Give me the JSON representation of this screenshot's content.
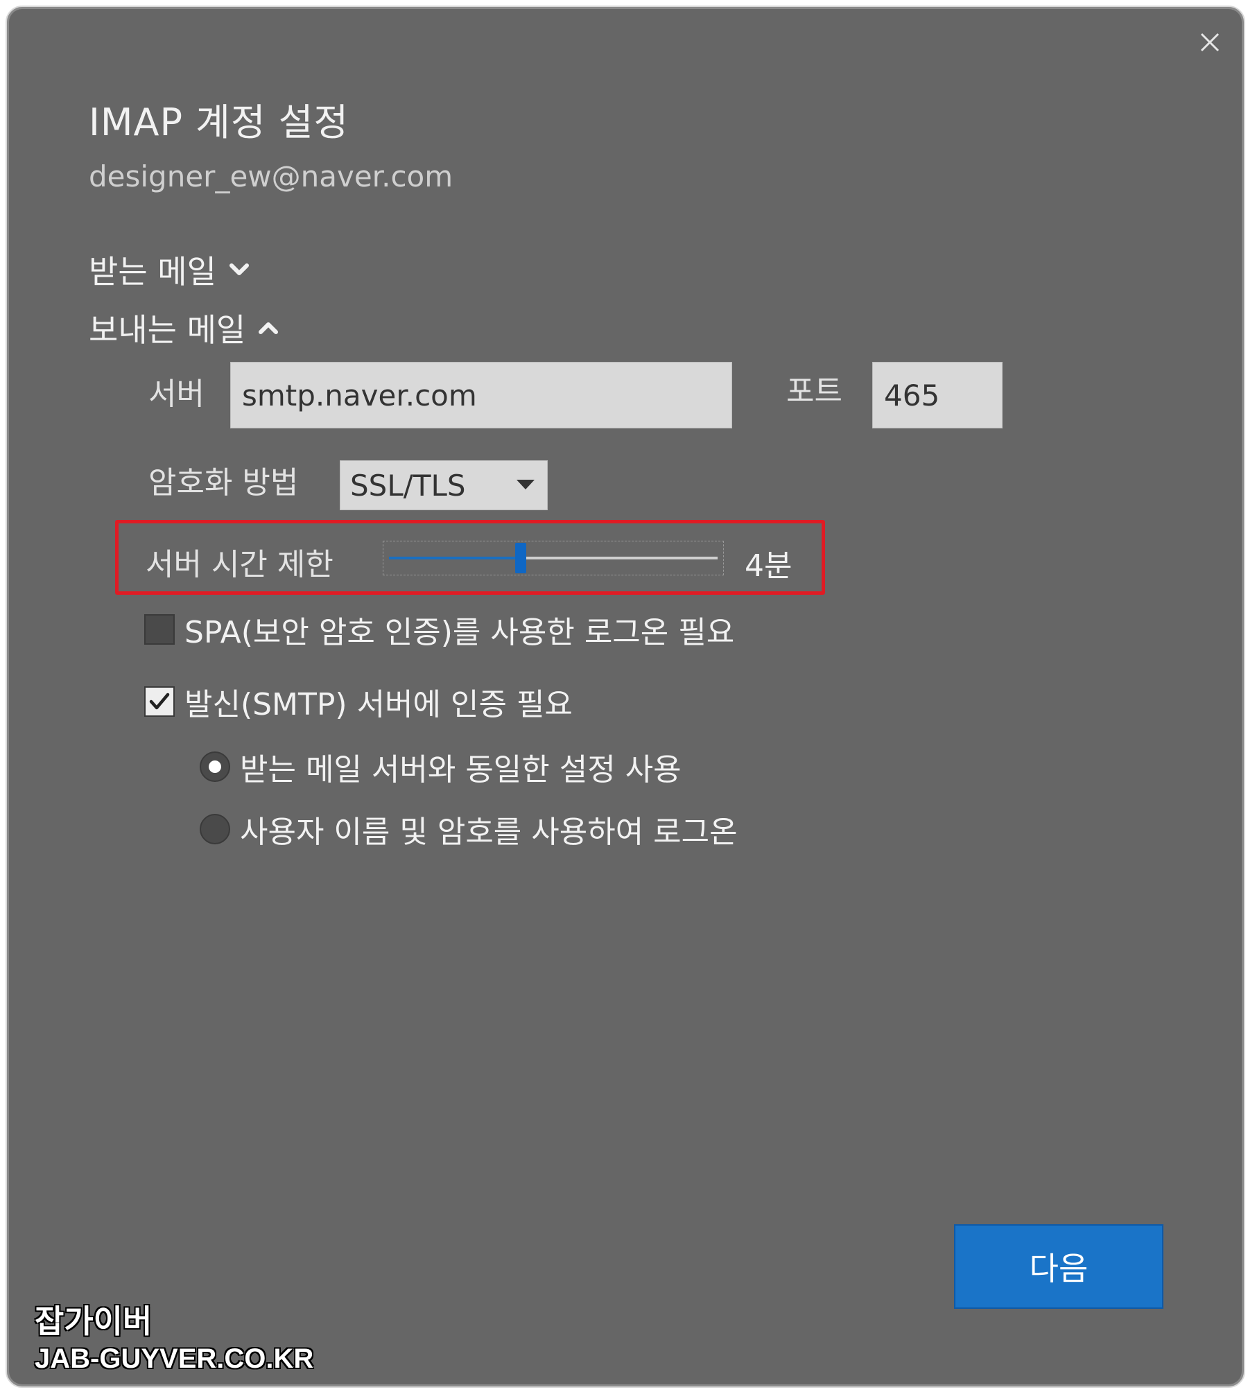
{
  "dialog": {
    "title": "IMAP 계정 설정",
    "account_email": "designer_ew@naver.com"
  },
  "incoming": {
    "label": "받는 메일",
    "expanded": false,
    "icon": "chevron-down-icon"
  },
  "outgoing": {
    "label": "보내는 메일",
    "expanded": true,
    "icon": "chevron-up-icon",
    "server_label": "서버",
    "server_value": "smtp.naver.com",
    "port_label": "포트",
    "port_value": "465",
    "encryption_label": "암호화 방법",
    "encryption_value": "SSL/TLS",
    "timeout_label": "서버 시간 제한",
    "timeout_value_text": "4분",
    "timeout_level_fraction": 0.4,
    "spa_label": "SPA(보안 암호 인증)를 사용한 로그온 필요",
    "spa_checked": false,
    "smtp_auth_label": "발신(SMTP) 서버에 인증 필요",
    "smtp_auth_checked": true,
    "auth_options": [
      {
        "label": "받는 메일 서버와 동일한 설정 사용",
        "selected": true
      },
      {
        "label": "사용자 이름 및 암호를 사용하여 로그온",
        "selected": false
      }
    ]
  },
  "footer": {
    "next_label": "다음"
  },
  "watermark": {
    "line1": "잡가이버",
    "line2": "JAB-GUYVER.CO.KR"
  },
  "colors": {
    "dialog_bg": "#666666",
    "accent_blue": "#1a74c8",
    "highlight_red": "#e01b24"
  }
}
